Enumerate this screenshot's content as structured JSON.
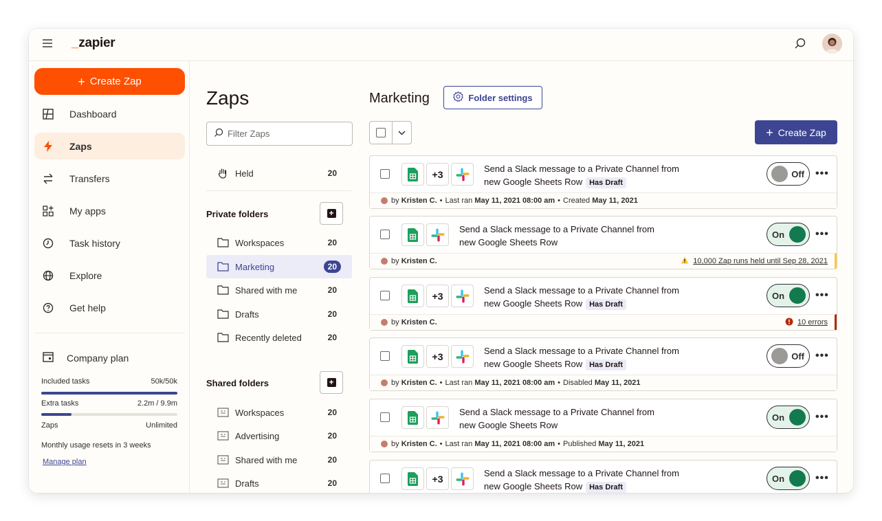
{
  "topbar": {
    "logo_mark": "_",
    "logo_text": "zapier"
  },
  "sidebar": {
    "create_label": "Create Zap",
    "items": [
      {
        "label": "Dashboard",
        "icon": "dashboard-icon"
      },
      {
        "label": "Zaps",
        "icon": "zap-icon",
        "active": true
      },
      {
        "label": "Transfers",
        "icon": "transfers-icon"
      },
      {
        "label": "My apps",
        "icon": "apps-icon"
      },
      {
        "label": "Task history",
        "icon": "history-icon"
      },
      {
        "label": "Explore",
        "icon": "globe-icon"
      },
      {
        "label": "Get help",
        "icon": "help-icon"
      }
    ],
    "plan": {
      "label": "Company plan",
      "included_label": "Included tasks",
      "included_value": "50k/50k",
      "included_fill": 1.0,
      "extra_label": "Extra tasks",
      "extra_value": "2.2m / 9.9m",
      "extra_fill": 0.22,
      "zaps_label": "Zaps",
      "zaps_value": "Unlimited",
      "reset_note": "Monthly usage resets in 3 weeks",
      "manage_label": "Manage plan"
    }
  },
  "zaps_panel": {
    "title": "Zaps",
    "filter_placeholder": "Filter Zaps",
    "held": {
      "label": "Held",
      "count": "20"
    },
    "private_title": "Private folders",
    "private_folders": [
      {
        "label": "Workspaces",
        "count": "20"
      },
      {
        "label": "Marketing",
        "count": "20",
        "active": true
      },
      {
        "label": "Shared with me",
        "count": "20"
      },
      {
        "label": "Drafts",
        "count": "20"
      },
      {
        "label": "Recently deleted",
        "count": "20"
      }
    ],
    "shared_title": "Shared folders",
    "shared_folders": [
      {
        "label": "Workspaces",
        "count": "20"
      },
      {
        "label": "Advertising",
        "count": "20"
      },
      {
        "label": "Shared with me",
        "count": "20"
      },
      {
        "label": "Drafts",
        "count": "20"
      }
    ]
  },
  "main": {
    "title": "Marketing",
    "folder_settings_label": "Folder settings",
    "create_label": "Create Zap",
    "zaps": [
      {
        "line1": "Send a Slack message to a Private Channel from",
        "line2": "new Google Sheets Row",
        "plus": "+3",
        "draft": "Has Draft",
        "status": "Off",
        "meta_by": "by",
        "meta_author": "Kristen C.",
        "meta_sep1": "•",
        "meta_lastran_label": "Last ran",
        "meta_lastran": "May 11, 2021 08:00 am",
        "meta_sep2": "•",
        "meta_event_label": "Created",
        "meta_event": "May 11, 2021"
      },
      {
        "line1": "Send a Slack message to a Private Channel from",
        "line2": "new Google Sheets Row",
        "plus": "",
        "draft": "",
        "status": "On",
        "meta_by": "by",
        "meta_author": "Kristen C.",
        "alert": "10,000 Zap runs held until Sep 28, 2021"
      },
      {
        "line1": "Send a Slack message to a Private Channel from",
        "line2": "new Google Sheets Row",
        "plus": "+3",
        "draft": "Has Draft",
        "status": "On",
        "meta_by": "by",
        "meta_author": "Kristen C.",
        "errors": "10 errors"
      },
      {
        "line1": "Send a Slack message to a Private Channel from",
        "line2": "new Google Sheets Row",
        "plus": "+3",
        "draft": "Has Draft",
        "status": "Off",
        "meta_by": "by",
        "meta_author": "Kristen C.",
        "meta_sep1": "•",
        "meta_lastran_label": "Last ran",
        "meta_lastran": "May 11, 2021 08:00 am",
        "meta_sep2": "•",
        "meta_event_label": "Disabled",
        "meta_event": "May 11, 2021"
      },
      {
        "line1": "Send a Slack message to a Private Channel from",
        "line2": "new Google Sheets Row",
        "plus": "",
        "draft": "",
        "status": "On",
        "meta_by": "by",
        "meta_author": "Kristen C.",
        "meta_sep1": "•",
        "meta_lastran_label": "Last ran",
        "meta_lastran": "May 11, 2021 08:00 am",
        "meta_sep2": "•",
        "meta_event_label": "Published",
        "meta_event": "May 11, 2021"
      },
      {
        "line1": "Send a Slack message to a Private Channel from",
        "line2": "new Google Sheets Row",
        "plus": "+3",
        "draft": "Has Draft",
        "status": "On"
      }
    ]
  },
  "colors": {
    "brand_orange": "#ff4f00",
    "accent_blue": "#3d4592",
    "on_green": "#13794f",
    "warning": "#ffc93c",
    "error": "#b22a0a"
  }
}
